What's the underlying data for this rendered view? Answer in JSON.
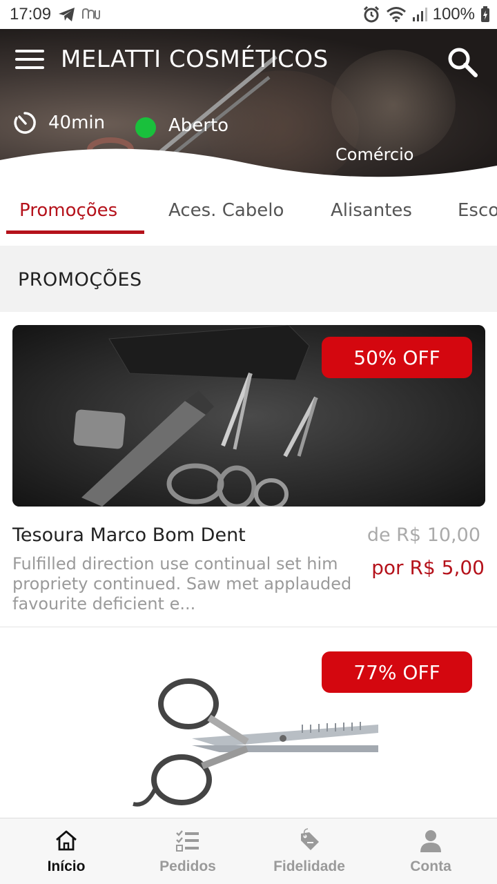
{
  "status_bar": {
    "time": "17:09",
    "battery": "100%"
  },
  "header": {
    "store_name": "MELATTI COSMÉTICOS",
    "delivery_time": "40min",
    "open_status": "Aberto",
    "category": "Comércio",
    "status_color": "#19c03c"
  },
  "tabs": [
    {
      "label": "Promoções",
      "active": true
    },
    {
      "label": "Aces. Cabelo",
      "active": false
    },
    {
      "label": "Alisantes",
      "active": false
    },
    {
      "label": "Esco",
      "active": false
    }
  ],
  "section": {
    "title": "PROMOÇÕES"
  },
  "products": [
    {
      "discount": "50% OFF",
      "name": "Tesoura Marco Bom Dent",
      "description": "Fulfilled direction use continual set him propriety continued. Saw met applauded favourite deficient e...",
      "price_old": "de R$ 10,00",
      "price_new": "por R$ 5,00"
    },
    {
      "discount": "77% OFF"
    }
  ],
  "bottom_nav": [
    {
      "label": "Início",
      "icon": "home-icon",
      "active": true
    },
    {
      "label": "Pedidos",
      "icon": "orders-list-icon",
      "active": false
    },
    {
      "label": "Fidelidade",
      "icon": "loyalty-tag-icon",
      "active": false
    },
    {
      "label": "Conta",
      "icon": "account-person-icon",
      "active": false
    }
  ],
  "colors": {
    "accent": "#b5121b",
    "badge": "#d4070f"
  }
}
